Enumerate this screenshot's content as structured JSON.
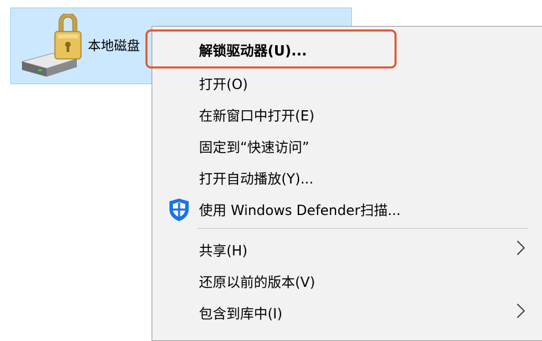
{
  "drive": {
    "label": "本地磁盘",
    "icon": "locked-drive-icon"
  },
  "menu": {
    "items": [
      {
        "label": "解锁驱动器(U)...",
        "bold": true
      },
      {
        "label": "打开(O)"
      },
      {
        "label": "在新窗口中打开(E)"
      },
      {
        "label": "固定到“快速访问”"
      },
      {
        "label": "打开自动播放(Y)..."
      },
      {
        "label": "使用 Windows Defender扫描...",
        "icon": "windows-defender-shield-icon"
      },
      {
        "label": "共享(H)",
        "submenu": true
      },
      {
        "label": "还原以前的版本(V)"
      },
      {
        "label": "包含到库中(I)",
        "submenu": true
      }
    ]
  },
  "colors": {
    "selection": "#cce8ff",
    "highlight_border": "#e05a3a",
    "defender_blue": "#1a73e8"
  }
}
